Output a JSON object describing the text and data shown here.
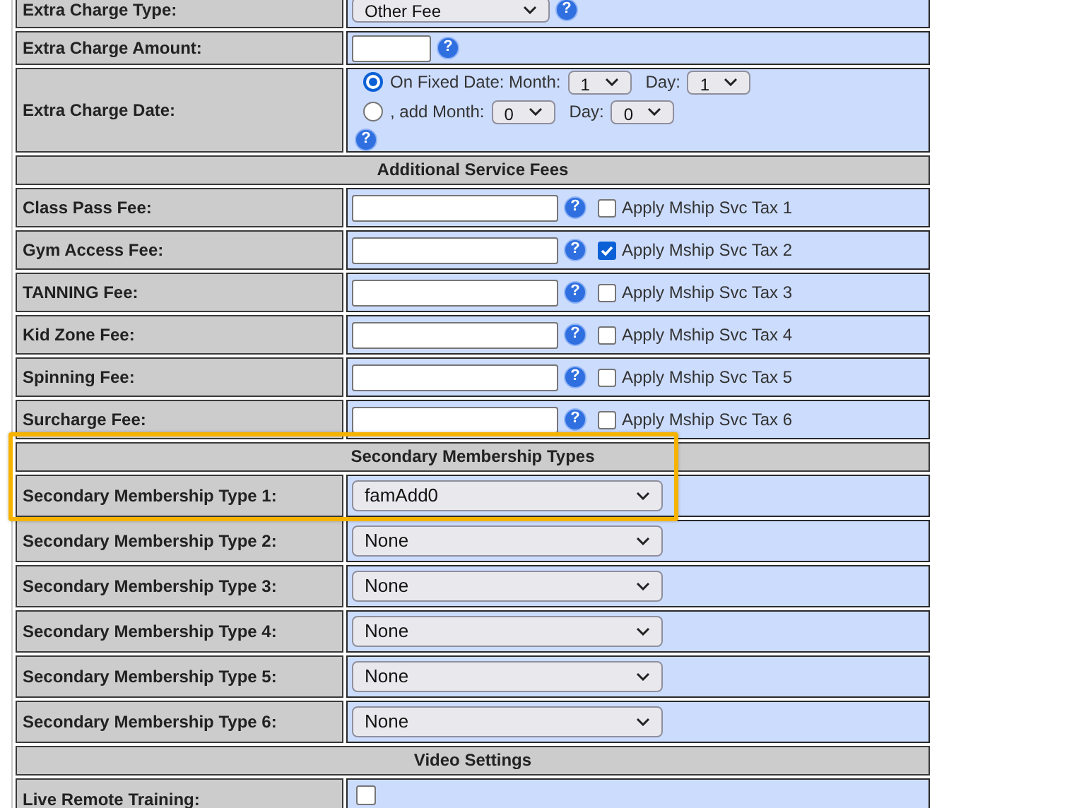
{
  "rows": [
    {
      "kind": "select",
      "label": "Extra Charge Type:",
      "value": "Other Fee",
      "help": "?"
    },
    {
      "kind": "input",
      "label": "Extra Charge Amount:",
      "help": "?"
    },
    {
      "kind": "date",
      "label": "Extra Charge Date:",
      "help": "?",
      "options": [
        {
          "selected": true,
          "text": "On Fixed Date: Month:",
          "month": "1",
          "day_label": "Day:",
          "day": "1"
        },
        {
          "selected": false,
          "text": ", add Month:",
          "month": "0",
          "day_label": "Day:",
          "day": "0"
        }
      ]
    }
  ],
  "additional_service_fees": {
    "title": "Additional Service Fees",
    "rows": [
      {
        "label": "Class Pass Fee:",
        "help": "?",
        "tax_label": "Apply Mship Svc Tax 1",
        "checked": false
      },
      {
        "label": "Gym Access Fee:",
        "help": "?",
        "tax_label": "Apply Mship Svc Tax 2",
        "checked": true
      },
      {
        "label": "TANNING Fee:",
        "help": "?",
        "tax_label": "Apply Mship Svc Tax 3",
        "checked": false
      },
      {
        "label": "Kid Zone Fee:",
        "help": "?",
        "tax_label": "Apply Mship Svc Tax 4",
        "checked": false
      },
      {
        "label": "Spinning Fee:",
        "help": "?",
        "tax_label": "Apply Mship Svc Tax 5",
        "checked": false
      },
      {
        "label": "Surcharge Fee:",
        "help": "?",
        "tax_label": "Apply Mship Svc Tax 6",
        "checked": false
      }
    ]
  },
  "secondary_membership_types": {
    "title": "Secondary Membership Types",
    "highlighted": true,
    "rows": [
      {
        "label": "Secondary Membership Type 1:",
        "value": "famAdd0"
      },
      {
        "label": "Secondary Membership Type 2:",
        "value": "None"
      },
      {
        "label": "Secondary Membership Type 3:",
        "value": "None"
      },
      {
        "label": "Secondary Membership Type 4:",
        "value": "None"
      },
      {
        "label": "Secondary Membership Type 5:",
        "value": "None"
      },
      {
        "label": "Secondary Membership Type 6:",
        "value": "None"
      }
    ]
  },
  "video_settings": {
    "title": "Video Settings",
    "rows": [
      {
        "label": "Live Remote Training:",
        "checked": false
      }
    ]
  }
}
